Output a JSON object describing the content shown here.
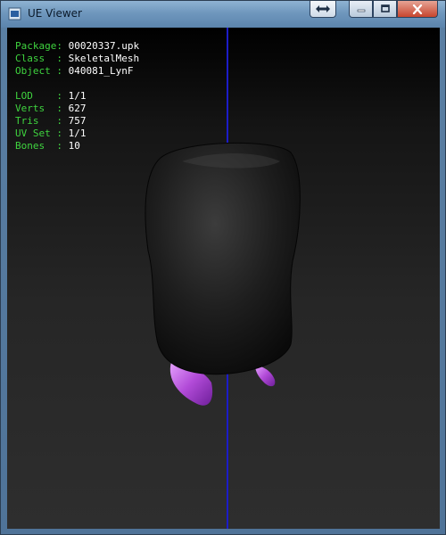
{
  "window": {
    "title": "UE Viewer"
  },
  "titlebar_buttons": {
    "swap_icon": "left-right-arrow-icon",
    "min_icon": "minimize-icon",
    "max_icon": "maximize-icon",
    "close_icon": "close-icon"
  },
  "info": {
    "package": {
      "key": "Package: ",
      "value": "00020337.upk"
    },
    "class": {
      "key": "Class  : ",
      "value": "SkeletalMesh"
    },
    "object": {
      "key": "Object : ",
      "value": "040081_LynF"
    },
    "lod": {
      "key": "LOD    : ",
      "value": "1/1"
    },
    "verts": {
      "key": "Verts  : ",
      "value": "627"
    },
    "tris": {
      "key": "Tris   : ",
      "value": "757"
    },
    "uvset": {
      "key": "UV Set : ",
      "value": "1/1"
    },
    "bones": {
      "key": "Bones  : ",
      "value": "10"
    }
  },
  "colors": {
    "label": "#3fd43f",
    "value": "#ffffff",
    "axis": "#1c1cc8",
    "hair": "#b24bd8"
  }
}
